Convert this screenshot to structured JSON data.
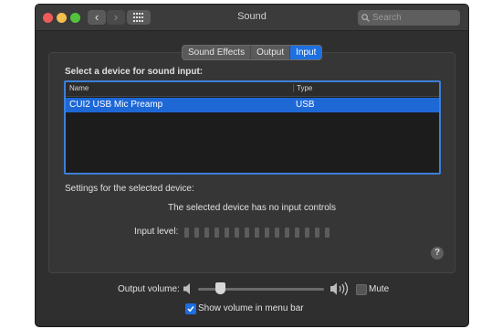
{
  "window": {
    "title": "Sound"
  },
  "search": {
    "placeholder": "Search"
  },
  "tabs": [
    {
      "label": "Sound Effects",
      "active": false
    },
    {
      "label": "Output",
      "active": false
    },
    {
      "label": "Input",
      "active": true
    }
  ],
  "input": {
    "heading": "Select a device for sound input:",
    "table": {
      "columns": [
        "Name",
        "Type"
      ],
      "rows": [
        {
          "name": "CUI2 USB Mic Preamp",
          "type": "USB",
          "selected": true
        }
      ]
    },
    "settings_label": "Settings for the selected device:",
    "no_controls": "The selected device has no input controls",
    "input_level_label": "Input level:",
    "input_level_segments": 15
  },
  "footer": {
    "output_volume_label": "Output volume:",
    "output_volume_fraction": 0.18,
    "mute_label": "Mute",
    "mute_checked": false,
    "show_volume_label": "Show volume in menu bar",
    "show_volume_checked": true
  },
  "colors": {
    "accent": "#1e6fe0",
    "selection": "#1e68d6",
    "window_bg": "#2f2f2f"
  },
  "icons": [
    "back-icon",
    "forward-icon",
    "grid-icon",
    "search-icon",
    "speaker-low-icon",
    "speaker-high-icon",
    "help-icon",
    "checkmark-icon"
  ]
}
